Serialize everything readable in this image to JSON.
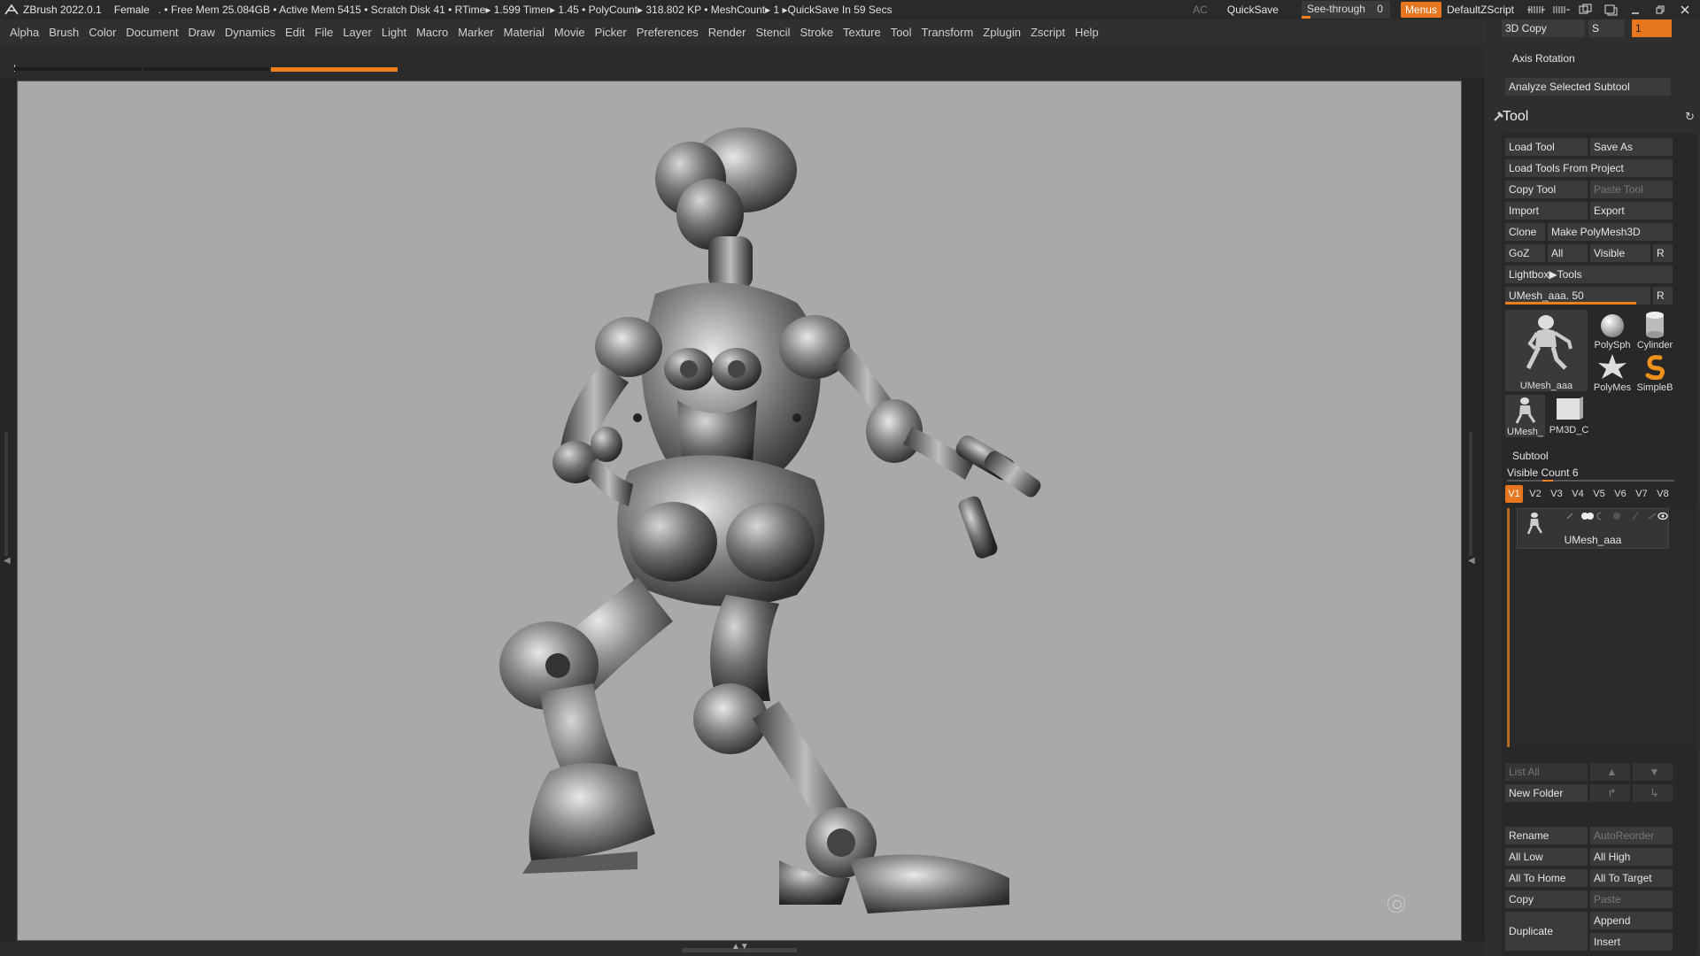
{
  "titlebar": {
    "app": "ZBrush 2022.0.1",
    "document": "Female",
    "stats": ". • Free Mem 25.084GB • Active Mem 5415 • Scratch Disk 41 •  RTime▸ 1.599 Timer▸ 1.45 • PolyCount▸ 318.802 KP  • MeshCount▸ 1  ▸QuickSave In 59 Secs",
    "ac": "AC",
    "quicksave": "QuickSave",
    "seethrough_label": "See-through",
    "seethrough_value": "0",
    "menus": "Menus",
    "script": "DefaultZScript"
  },
  "menubar": [
    "Alpha",
    "Brush",
    "Color",
    "Document",
    "Draw",
    "Dynamics",
    "Edit",
    "File",
    "Layer",
    "Light",
    "Macro",
    "Marker",
    "Material",
    "Movie",
    "Picker",
    "Preferences",
    "Render",
    "Stencil",
    "Stroke",
    "Texture",
    "Tool",
    "Transform",
    "Zplugin",
    "Zscript",
    "Help"
  ],
  "tray": {
    "top_3dcopy": "3D Copy",
    "top_s": "S",
    "top_input": "1",
    "axis_rotation": "Axis Rotation",
    "analyze": "Analyze Selected Subtool",
    "tool_title": "Tool",
    "load_tool": "Load Tool",
    "save_as": "Save As",
    "load_from_project": "Load Tools From Project",
    "copy_tool": "Copy Tool",
    "paste_tool": "Paste Tool",
    "import": "Import",
    "export": "Export",
    "clone": "Clone",
    "make_polymesh": "Make PolyMesh3D",
    "goz": "GoZ",
    "all": "All",
    "visible": "Visible",
    "r": "R",
    "lightbox_tools": "Lightbox▶Tools",
    "umesh_slider": "UMesh_aaa. 50",
    "umesh_slider_value": 0.9,
    "r2": "R",
    "thumbs": {
      "main": "UMesh_aaa",
      "polysphere": "PolySph",
      "cylinder": "Cylinder",
      "polymesh": "PolyMes",
      "simpleb": "SimpleB",
      "umesh_small": "UMesh_",
      "pm3d": "PM3D_C"
    },
    "subtool_title": "Subtool",
    "visible_count": "Visible Count 6",
    "versions": [
      "V1",
      "V2",
      "V3",
      "V4",
      "V5",
      "V6",
      "V7",
      "V8"
    ],
    "subtool_item": "UMesh_aaa",
    "list_all": "List All",
    "new_folder": "New Folder",
    "rename": "Rename",
    "autoreorder": "AutoReorder",
    "all_low": "All Low",
    "all_high": "All High",
    "all_to_home": "All To Home",
    "all_to_target": "All To Target",
    "copy": "Copy",
    "paste": "Paste",
    "duplicate": "Duplicate",
    "append": "Append",
    "insert": "Insert"
  },
  "colors": {
    "accent": "#e8761e",
    "viewport_bg": "#a9a9a9",
    "ui_bg": "#2b2b2b"
  }
}
